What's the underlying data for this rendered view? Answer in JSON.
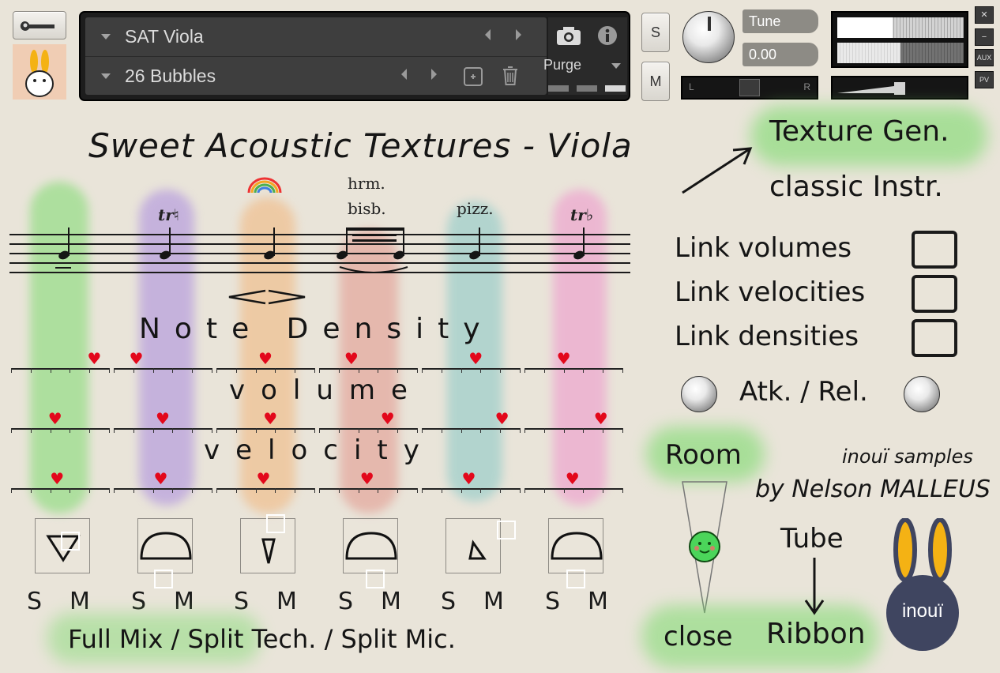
{
  "header": {
    "instrument": {
      "name": "SAT Viola"
    },
    "snapshot": {
      "name": "26 Bubbles"
    },
    "purge_label": "Purge",
    "s_label": "S",
    "m_label": "M",
    "tune": {
      "label": "Tune",
      "value": "0.00"
    },
    "pan_left": "L",
    "pan_right": "R",
    "side_buttons": [
      "✕",
      "−",
      "AUX",
      "PV"
    ]
  },
  "title": "Sweet Acoustic Textures - Viola",
  "mode": {
    "active": "Texture Gen.",
    "alt": "classic Instr."
  },
  "articulation_labels": {
    "harmonic_top": "hrm.",
    "harmonic_bottom": "bisb.",
    "pizz": "pizz."
  },
  "rows": {
    "density": "Note Density",
    "volume": "volume",
    "velocity": "velocity"
  },
  "links": [
    "Link volumes",
    "Link velocities",
    "Link densities"
  ],
  "atk_rel": "Atk. / Rel.",
  "room": {
    "label": "Room",
    "close": "close"
  },
  "credit": {
    "line1": "inouï samples",
    "line2": "by Nelson MALLEUS"
  },
  "tube": {
    "top": "Tube",
    "bottom": "Ribbon"
  },
  "logo_text": "inouï",
  "sm_labels": [
    "S",
    "M"
  ],
  "bottom_label": "Full Mix / Split Tech. / Split Mic.",
  "colors": {
    "green": "#7ddb6e",
    "purple": "#a98ae0",
    "orange": "#f2b57a",
    "red": "#e2958a",
    "teal": "#86c8c6",
    "pink": "#ef93cc",
    "heart": "#e3081b",
    "bunny_yellow": "#f4b214",
    "bunny_body": "#3f4560"
  },
  "icons": [
    "wrench-icon",
    "bunny-icon",
    "camera-icon",
    "info-icon",
    "save-icon",
    "trash-icon",
    "rainbow-icon",
    "arrow-icon"
  ],
  "columns": [
    {
      "name": "green",
      "density": 0.85,
      "volume": 0.45,
      "velocity": 0.47
    },
    {
      "name": "purple",
      "density": 0.23,
      "volume": 0.5,
      "velocity": 0.48
    },
    {
      "name": "orange",
      "density": 0.5,
      "volume": 0.55,
      "velocity": 0.48
    },
    {
      "name": "red",
      "density": 0.33,
      "volume": 0.7,
      "velocity": 0.49
    },
    {
      "name": "teal",
      "density": 0.55,
      "volume": 0.82,
      "velocity": 0.48
    },
    {
      "name": "pink",
      "density": 0.4,
      "volume": 0.78,
      "velocity": 0.49
    }
  ]
}
